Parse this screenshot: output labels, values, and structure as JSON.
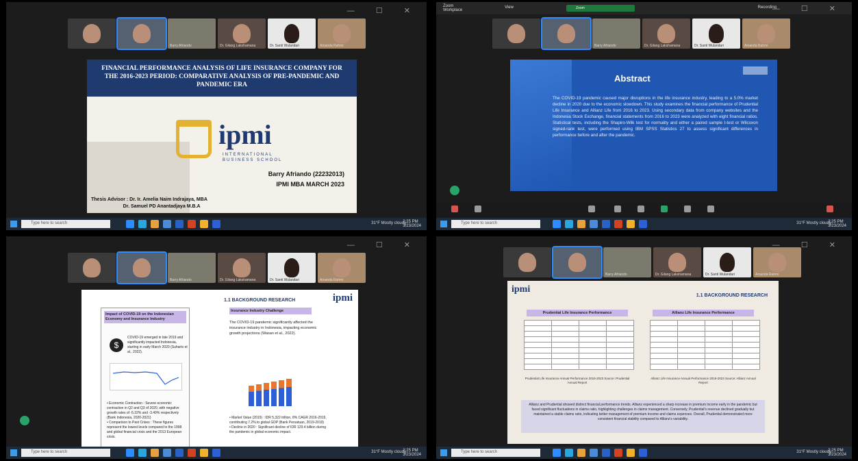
{
  "window": {
    "controls": "—  ☐  ✕"
  },
  "participants": [
    "",
    "",
    "Barry Afriando",
    "Dr. Gilang Lakshamana",
    "Dr. Santi Wulandari",
    "Amanda Rahmi"
  ],
  "taskbar": {
    "search_placeholder": "Type here to search",
    "tray": "31°F Mostly cloudy",
    "clock_time": "2:25 PM",
    "clock_date": "3/23/2024"
  },
  "q1": {
    "title": "FINANCIAL PERFORMANCE ANALYSIS OF LIFE INSURANCE COMPANY FOR THE 2016-2023 PERIOD: COMPARATIVE ANALYSIS OF PRE-PANDEMIC AND PANDEMIC ERA",
    "logo": "ipmi",
    "logo_sub": "INTERNATIONAL\nBUSINESS SCHOOL",
    "author": "Barry Afriando (22232013)",
    "program": "IPMI MBA MARCH 2023",
    "advisor": "Thesis Advisor : Dr. Ir. Amelia Naim Indrajaya, MBA\n                        Dr. Samuel PD Anantadjaya M.B.A"
  },
  "q2": {
    "topbar_left": "Zoom\nWorkplace",
    "view": "View",
    "shield": "Zoom",
    "recording": "Recording",
    "heading": "Abstract",
    "body": "The COVID-19 pandemic caused major disruptions in the life insurance industry, leading to a 5.0% market decline in 2020 due to the economic slowdown. This study examines the financial performance of Prudential Life Insurance and Allianz Life from 2016 to 2023. Using secondary data from company websites and the Indonesia Stock Exchange, financial statements from 2016 to 2023 were analyzed with eight financial ratios. Statistical tests, including the Shapiro-Wilk test for normality and either a paired sample t-test or Wilcoxon signed-rank test, were performed using IBM SPSS Statistics 27 to assess significant differences in performance before and after the pandemic."
  },
  "q3": {
    "heading": "1.1 BACKGROUND RESEARCH",
    "logo": "ipmi",
    "left_title": "Impact of COVID-19 on the Indonesian Economy and Insurance Industry",
    "left_para": "COVID-19 emerged in late 2019 and significantly impacted Indonesia, starting in early March 2020 (Suharto et al., 2022).",
    "left_bullets": "• Economic Contraction : Severe economic contraction in Q2 and Q3 of 2020, with negative growth rates of -5.32% and -3.49% respectively (Bank Indonesia, 2020-2021)\n• Comparison to Past Crises : These figures represent the lowest levels compared to the 1998 and global financial crisis and the 2013 European crisis.",
    "right_title": "Insurance Industry Challenge",
    "right_para": "The COVID-19 pandemic significantly affected the insurance industry in Indonesia, impacting economic growth projections (Wasan et al., 2022).",
    "right_bullets": "• Market Value (2019) : IDR 5,322 trillion, 8% CAGR 2016-2019, contributing 7.2% to global GDP (Bank Persatuan, 2019-2019)\n• Decline in 2020 : Significant decline of IDR 129.4 billion during the pandemic in global economic impact."
  },
  "q4": {
    "logo": "ipmi",
    "heading": "1.1 BACKGROUND RESEARCH",
    "table1_title": "Prudential Life Insurance Performance",
    "table2_title": "Allianz Life Insurance Performance",
    "caption1": "Prudential Life Insurance Annual Performance 2016-2023\nSource: Prudential Annual Report",
    "caption2": "Allianz Life Insurance Annual Performance 2016-2023\nSource: Allianz Annual Report",
    "note": "Allianz and Prudential showed distinct financial performance trends. Allianz experienced a sharp increase in premium income early in the pandemic but faced significant fluctuations in claims ratio, highlighting challenges in claims management. Conversely, Prudential's revenue declined gradually but maintained a stable claims ratio, indicating better management of premium income and claims expenses. Overall, Prudential demonstrated more consistent financial stability compared to Allianz's variability."
  }
}
